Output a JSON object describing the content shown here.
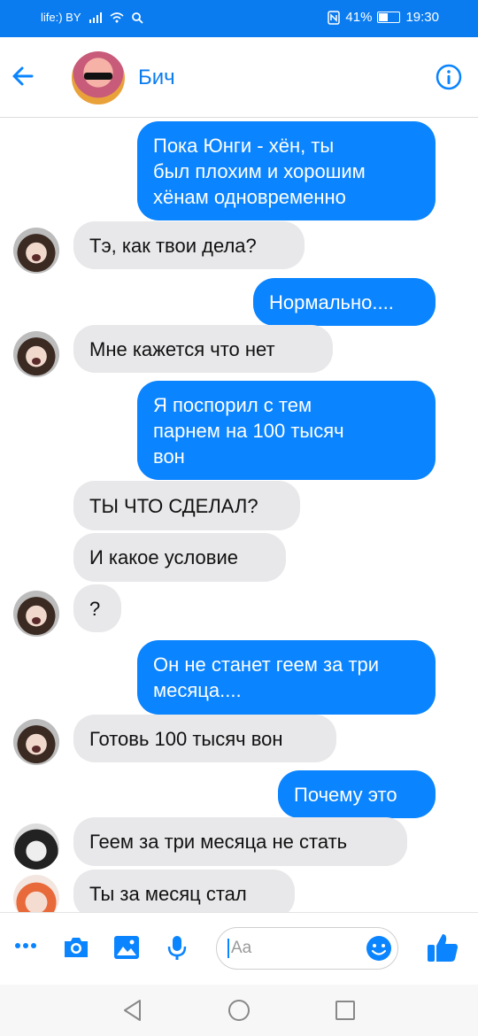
{
  "status": {
    "carrier": "life:) BY",
    "battery": "41%",
    "time": "19:30"
  },
  "header": {
    "title": "Бич"
  },
  "messages": [
    {
      "side": "out",
      "text": "Пока Юнги - хён, ты\nбыл плохим и хорошим\nхёнам одновременно"
    },
    {
      "side": "in",
      "text": "Тэ, как твои дела?"
    },
    {
      "side": "out",
      "text": "Нормально...."
    },
    {
      "side": "in",
      "text": "Мне кажется что нет"
    },
    {
      "side": "out",
      "text": "Я поспорил с тем\nпарнем на 100 тысяч\nвон"
    },
    {
      "side": "in",
      "text": "ТЫ ЧТО СДЕЛАЛ?"
    },
    {
      "side": "in",
      "text": "И какое условие"
    },
    {
      "side": "in",
      "text": "?"
    },
    {
      "side": "out",
      "text": "Он не станет геем за три\nмесяца...."
    },
    {
      "side": "in",
      "text": "Готовь 100 тысяч вон"
    },
    {
      "side": "out",
      "text": "Почему это"
    },
    {
      "side": "in",
      "text": "Геем за три месяца не стать"
    },
    {
      "side": "in",
      "text": "Ты за месяц стал"
    }
  ],
  "composer": {
    "placeholder": "Aa"
  },
  "colors": {
    "accent": "#0a84ff",
    "incoming": "#e8e8ea"
  },
  "icons": [
    "more-icon",
    "camera-icon",
    "gallery-icon",
    "microphone-icon",
    "emoji-icon",
    "like-icon",
    "back-arrow-icon",
    "info-icon"
  ]
}
